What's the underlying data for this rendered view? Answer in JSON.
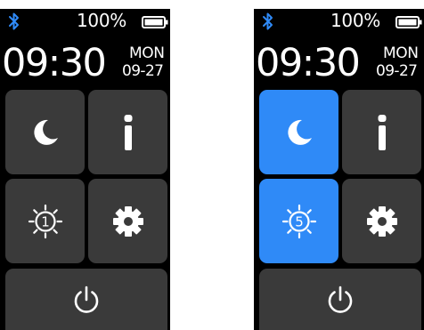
{
  "screens": [
    {
      "status": {
        "battery_percent": "100%",
        "bluetooth_icon": "bluetooth-icon",
        "battery_icon": "battery-full-icon"
      },
      "clock": {
        "time": "09:30",
        "day": "MON",
        "date": "09-27"
      },
      "tiles": {
        "dnd": {
          "icon": "moon-icon",
          "active": false
        },
        "info": {
          "icon": "info-icon",
          "active": false
        },
        "brightness": {
          "icon": "brightness-icon",
          "level": "1",
          "active": false
        },
        "settings": {
          "icon": "gear-icon",
          "active": false
        },
        "power": {
          "icon": "power-icon",
          "active": false
        }
      }
    },
    {
      "status": {
        "battery_percent": "100%",
        "bluetooth_icon": "bluetooth-icon",
        "battery_icon": "battery-full-icon"
      },
      "clock": {
        "time": "09:30",
        "day": "MON",
        "date": "09-27"
      },
      "tiles": {
        "dnd": {
          "icon": "moon-icon",
          "active": true
        },
        "info": {
          "icon": "info-icon",
          "active": false
        },
        "brightness": {
          "icon": "brightness-icon",
          "level": "5",
          "active": true
        },
        "settings": {
          "icon": "gear-icon",
          "active": false
        },
        "power": {
          "icon": "power-icon",
          "active": false
        }
      }
    }
  ],
  "colors": {
    "screen_bg": "#000000",
    "tile_bg": "#3a3a3a",
    "tile_active_bg": "#2f8af7",
    "bluetooth": "#2f8af7",
    "text": "#ffffff"
  }
}
